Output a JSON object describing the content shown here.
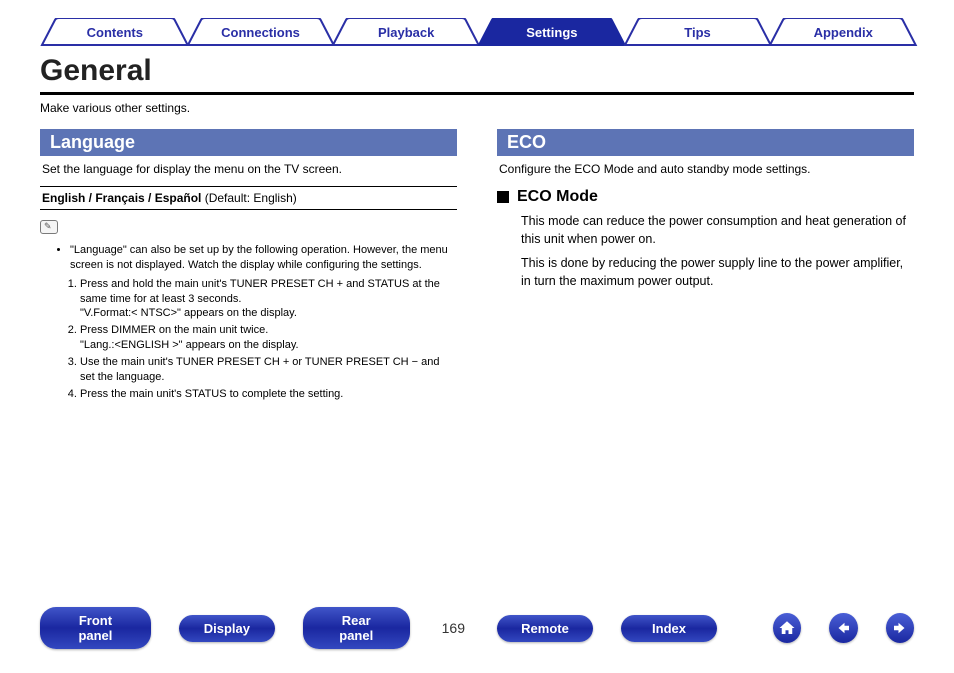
{
  "tabs": [
    {
      "label": "Contents",
      "active": false
    },
    {
      "label": "Connections",
      "active": false
    },
    {
      "label": "Playback",
      "active": false
    },
    {
      "label": "Settings",
      "active": true
    },
    {
      "label": "Tips",
      "active": false
    },
    {
      "label": "Appendix",
      "active": false
    }
  ],
  "page_title": "General",
  "subtitle": "Make various other settings.",
  "left": {
    "header": "Language",
    "desc": "Set the language for display the menu on the TV screen.",
    "options_bold": "English / Français / Español",
    "options_default": " (Default: English)",
    "note_bullet": "\"Language\" can also be set up by the following operation. However, the menu screen is not displayed. Watch the display while configuring the settings.",
    "steps": [
      "Press and hold the main unit's TUNER PRESET CH + and STATUS at the same time for at least 3 seconds.",
      "\"V.Format:< NTSC>\" appears on the display.",
      "Press DIMMER on the main unit twice.",
      "\"Lang.:<ENGLISH >\" appears on the display.",
      "Use the main unit's TUNER PRESET CH + or TUNER PRESET CH − and set the language.",
      "Press the main unit's STATUS to complete the setting."
    ]
  },
  "right": {
    "header": "ECO",
    "desc": "Configure the ECO Mode and auto standby mode settings.",
    "sub_heading": "ECO Mode",
    "body1": "This mode can reduce the power consumption and heat generation of this unit when power on.",
    "body2": "This is done by reducing the power supply line to the power amplifier, in turn the maximum power output."
  },
  "footer": {
    "buttons": [
      "Front panel",
      "Display",
      "Rear panel"
    ],
    "page": "169",
    "buttons2": [
      "Remote",
      "Index"
    ]
  }
}
